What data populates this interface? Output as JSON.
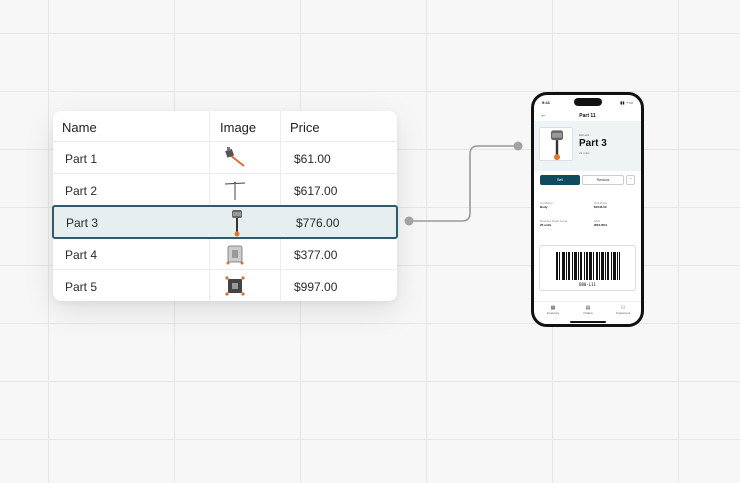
{
  "table": {
    "headers": {
      "name": "Name",
      "image": "Image",
      "price": "Price"
    },
    "rows": [
      {
        "name": "Part 1",
        "image_icon": "hammer-part-icon",
        "price": "$61.00"
      },
      {
        "name": "Part 2",
        "image_icon": "antenna-part-icon",
        "price": "$617.00"
      },
      {
        "name": "Part 3",
        "image_icon": "motor-mount-part-icon",
        "price": "$776.00"
      },
      {
        "name": "Part 4",
        "image_icon": "frame-part-icon",
        "price": "$377.00"
      },
      {
        "name": "Part 5",
        "image_icon": "board-part-icon",
        "price": "$997.00"
      }
    ],
    "selected_row": 2
  },
  "phone": {
    "status_time": "9:41",
    "header_title": "Part 11",
    "hero_subtitle": "Acc-ent",
    "hero_name": "Part 3",
    "hero_units": "22 units",
    "sell_label": "Sell",
    "restock_label": "Restock",
    "more_label": "⋯",
    "details": [
      {
        "key": "Condition",
        "value": "Body"
      },
      {
        "key": "Unit Price",
        "value": "$1543.00"
      },
      {
        "key": "Reorder Stock Level",
        "value": "25 units"
      },
      {
        "key": "SKU",
        "value": "W10-W11"
      }
    ],
    "barcode_text": "B80-L11",
    "tabs": [
      {
        "icon": "inventory-icon",
        "label": "Inventory"
      },
      {
        "icon": "orders-icon",
        "label": "Orders"
      },
      {
        "icon": "customers-icon",
        "label": "Customers"
      }
    ]
  },
  "colors": {
    "accent": "#0e4b5c",
    "selected_row_bg": "#e6eef0",
    "selected_row_border": "#2c5c6c",
    "connector": "#9a9a9a"
  }
}
